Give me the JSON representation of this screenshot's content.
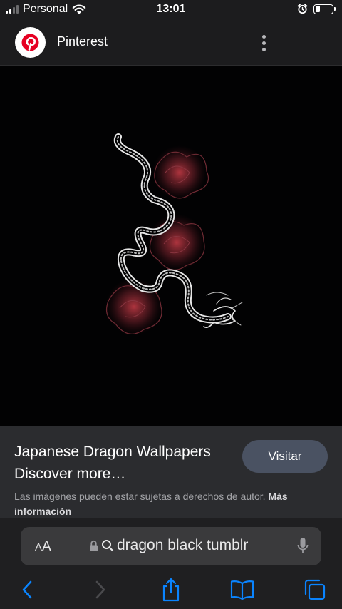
{
  "status_bar": {
    "carrier": "Personal",
    "time": "13:01",
    "battery_level": 0.3
  },
  "header": {
    "app_name": "Pinterest",
    "logo_icon": "pinterest-logo-icon",
    "menu_icon": "more-vertical-icon"
  },
  "pin": {
    "title": "Japanese Dragon Wallpapers Discover more…",
    "visit_label": "Visitar",
    "copyright_text": "Las imágenes pueden estar sujetas a derechos de autor.",
    "more_info_label": "Más información"
  },
  "browser": {
    "text_size_label_small": "A",
    "text_size_label_big": "A",
    "url": "dragon black tumblr",
    "icons": [
      "lock-icon",
      "search-icon",
      "microphone-icon",
      "back-icon",
      "forward-icon",
      "share-icon",
      "bookmarks-icon",
      "tabs-icon"
    ]
  },
  "colors": {
    "accent": "#0a84ff",
    "pinterest_red": "#e60023",
    "background": "#1c1c1e"
  }
}
